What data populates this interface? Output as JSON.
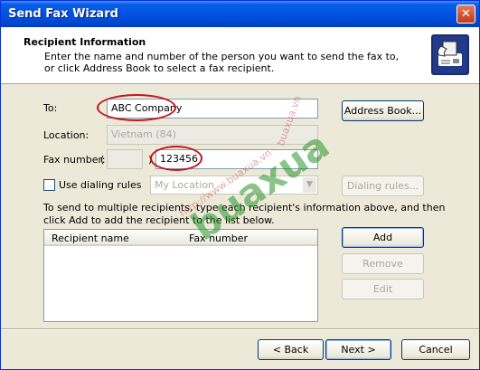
{
  "window": {
    "title": "Send Fax Wizard"
  },
  "header": {
    "title": "Recipient Information",
    "desc_line1": "Enter the name and number of the person you want to send the fax to,",
    "desc_line2": "or click Address Book to select a fax recipient.",
    "icon": "fax-machine-icon"
  },
  "form": {
    "to_label": "To:",
    "to_value": "ABC Company",
    "location_label": "Location:",
    "location_value": "Vietnam (84)",
    "fax_label": "Fax number:",
    "fax_paren_open": "(",
    "fax_paren_close": ")",
    "fax_value": "123456",
    "dialing_rules_label": "Use dialing rules",
    "dialing_location": "My Location",
    "multi_line1": "To send to multiple recipients, type each recipient's information above, and then",
    "multi_line2": "click Add to add the recipient to the list below."
  },
  "buttons": {
    "address_book": "Address Book...",
    "dialing_rules": "Dialing rules...",
    "add": "Add",
    "remove": "Remove",
    "edit": "Edit",
    "back": "< Back",
    "next": "Next >",
    "cancel": "Cancel"
  },
  "list": {
    "columns": [
      "Recipient name",
      "Fax number"
    ]
  },
  "watermark": {
    "text": "buaxua",
    "url": "http://www.buaxua.vn",
    "url2": "buaxua.vn"
  },
  "colors": {
    "title_bar": "#0054e3",
    "highlight_oval": "#c3141e",
    "dialog_bg": "#ece9d8"
  }
}
